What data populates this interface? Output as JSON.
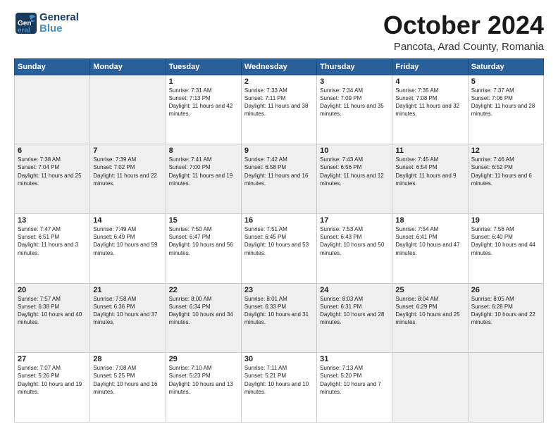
{
  "header": {
    "logo_line1": "General",
    "logo_line2": "Blue",
    "month": "October 2024",
    "location": "Pancota, Arad County, Romania"
  },
  "days_of_week": [
    "Sunday",
    "Monday",
    "Tuesday",
    "Wednesday",
    "Thursday",
    "Friday",
    "Saturday"
  ],
  "weeks": [
    [
      {
        "day": "",
        "info": ""
      },
      {
        "day": "",
        "info": ""
      },
      {
        "day": "1",
        "info": "Sunrise: 7:31 AM\nSunset: 7:13 PM\nDaylight: 11 hours and 42 minutes."
      },
      {
        "day": "2",
        "info": "Sunrise: 7:33 AM\nSunset: 7:11 PM\nDaylight: 11 hours and 38 minutes."
      },
      {
        "day": "3",
        "info": "Sunrise: 7:34 AM\nSunset: 7:09 PM\nDaylight: 11 hours and 35 minutes."
      },
      {
        "day": "4",
        "info": "Sunrise: 7:35 AM\nSunset: 7:08 PM\nDaylight: 11 hours and 32 minutes."
      },
      {
        "day": "5",
        "info": "Sunrise: 7:37 AM\nSunset: 7:06 PM\nDaylight: 11 hours and 28 minutes."
      }
    ],
    [
      {
        "day": "6",
        "info": "Sunrise: 7:38 AM\nSunset: 7:04 PM\nDaylight: 11 hours and 25 minutes."
      },
      {
        "day": "7",
        "info": "Sunrise: 7:39 AM\nSunset: 7:02 PM\nDaylight: 11 hours and 22 minutes."
      },
      {
        "day": "8",
        "info": "Sunrise: 7:41 AM\nSunset: 7:00 PM\nDaylight: 11 hours and 19 minutes."
      },
      {
        "day": "9",
        "info": "Sunrise: 7:42 AM\nSunset: 6:58 PM\nDaylight: 11 hours and 16 minutes."
      },
      {
        "day": "10",
        "info": "Sunrise: 7:43 AM\nSunset: 6:56 PM\nDaylight: 11 hours and 12 minutes."
      },
      {
        "day": "11",
        "info": "Sunrise: 7:45 AM\nSunset: 6:54 PM\nDaylight: 11 hours and 9 minutes."
      },
      {
        "day": "12",
        "info": "Sunrise: 7:46 AM\nSunset: 6:52 PM\nDaylight: 11 hours and 6 minutes."
      }
    ],
    [
      {
        "day": "13",
        "info": "Sunrise: 7:47 AM\nSunset: 6:51 PM\nDaylight: 11 hours and 3 minutes."
      },
      {
        "day": "14",
        "info": "Sunrise: 7:49 AM\nSunset: 6:49 PM\nDaylight: 10 hours and 59 minutes."
      },
      {
        "day": "15",
        "info": "Sunrise: 7:50 AM\nSunset: 6:47 PM\nDaylight: 10 hours and 56 minutes."
      },
      {
        "day": "16",
        "info": "Sunrise: 7:51 AM\nSunset: 6:45 PM\nDaylight: 10 hours and 53 minutes."
      },
      {
        "day": "17",
        "info": "Sunrise: 7:53 AM\nSunset: 6:43 PM\nDaylight: 10 hours and 50 minutes."
      },
      {
        "day": "18",
        "info": "Sunrise: 7:54 AM\nSunset: 6:41 PM\nDaylight: 10 hours and 47 minutes."
      },
      {
        "day": "19",
        "info": "Sunrise: 7:56 AM\nSunset: 6:40 PM\nDaylight: 10 hours and 44 minutes."
      }
    ],
    [
      {
        "day": "20",
        "info": "Sunrise: 7:57 AM\nSunset: 6:38 PM\nDaylight: 10 hours and 40 minutes."
      },
      {
        "day": "21",
        "info": "Sunrise: 7:58 AM\nSunset: 6:36 PM\nDaylight: 10 hours and 37 minutes."
      },
      {
        "day": "22",
        "info": "Sunrise: 8:00 AM\nSunset: 6:34 PM\nDaylight: 10 hours and 34 minutes."
      },
      {
        "day": "23",
        "info": "Sunrise: 8:01 AM\nSunset: 6:33 PM\nDaylight: 10 hours and 31 minutes."
      },
      {
        "day": "24",
        "info": "Sunrise: 8:03 AM\nSunset: 6:31 PM\nDaylight: 10 hours and 28 minutes."
      },
      {
        "day": "25",
        "info": "Sunrise: 8:04 AM\nSunset: 6:29 PM\nDaylight: 10 hours and 25 minutes."
      },
      {
        "day": "26",
        "info": "Sunrise: 8:05 AM\nSunset: 6:28 PM\nDaylight: 10 hours and 22 minutes."
      }
    ],
    [
      {
        "day": "27",
        "info": "Sunrise: 7:07 AM\nSunset: 5:26 PM\nDaylight: 10 hours and 19 minutes."
      },
      {
        "day": "28",
        "info": "Sunrise: 7:08 AM\nSunset: 5:25 PM\nDaylight: 10 hours and 16 minutes."
      },
      {
        "day": "29",
        "info": "Sunrise: 7:10 AM\nSunset: 5:23 PM\nDaylight: 10 hours and 13 minutes."
      },
      {
        "day": "30",
        "info": "Sunrise: 7:11 AM\nSunset: 5:21 PM\nDaylight: 10 hours and 10 minutes."
      },
      {
        "day": "31",
        "info": "Sunrise: 7:13 AM\nSunset: 5:20 PM\nDaylight: 10 hours and 7 minutes."
      },
      {
        "day": "",
        "info": ""
      },
      {
        "day": "",
        "info": ""
      }
    ]
  ]
}
